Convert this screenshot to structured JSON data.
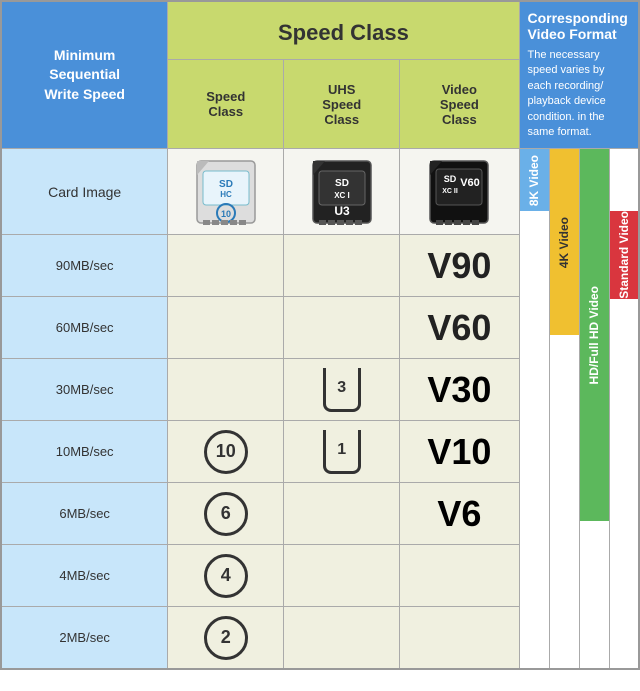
{
  "header": {
    "speed_class_label": "Speed Class",
    "min_seq_write": "Minimum\nSequential\nWrite Speed",
    "sub_headers": [
      "Speed\nClass",
      "UHS\nSpeed\nClass",
      "Video\nSpeed\nClass"
    ]
  },
  "card_image_label": "Card Image",
  "video_format": {
    "title": "Corresponding Video Format",
    "desc": "The necessary speed varies by each recording/ playback device condition. in the same format."
  },
  "rows": [
    {
      "speed": "90MB/sec",
      "sc": "",
      "uhs": "",
      "vsc": "V90"
    },
    {
      "speed": "60MB/sec",
      "sc": "",
      "uhs": "",
      "vsc": "V60"
    },
    {
      "speed": "30MB/sec",
      "sc": "",
      "uhs": "U3",
      "vsc": "V30"
    },
    {
      "speed": "10MB/sec",
      "sc": "10",
      "uhs": "U1",
      "vsc": "V10"
    },
    {
      "speed": "6MB/sec",
      "sc": "6",
      "uhs": "",
      "vsc": "V6"
    },
    {
      "speed": "4MB/sec",
      "sc": "4",
      "uhs": "",
      "vsc": ""
    },
    {
      "speed": "2MB/sec",
      "sc": "2",
      "uhs": "",
      "vsc": ""
    }
  ],
  "video_bars": [
    {
      "label": "8K Video",
      "color": "#6ab0e8",
      "start_row": 0,
      "rows": 1
    },
    {
      "label": "4K Video",
      "color": "#f0c030",
      "start_row": 0,
      "rows": 3
    },
    {
      "label": "HD/Full HD Video",
      "color": "#5cb85c",
      "start_row": 0,
      "rows": 6
    },
    {
      "label": "Standard Video",
      "color": "#d9363e",
      "start_row": 1,
      "rows": 6
    }
  ]
}
